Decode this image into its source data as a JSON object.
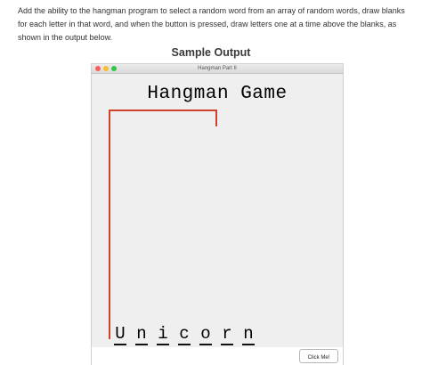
{
  "instructions": {
    "text": "Add the ability to the hangman program to select a random word from an array of random words, draw blanks for each letter in that word, and when the button is pressed, draw letters one at a time above the blanks, as shown in the output below."
  },
  "sample_heading": "Sample Output",
  "window": {
    "title": "Hangman Part II",
    "game_title": "Hangman Game",
    "letters": [
      "U",
      "n",
      "i",
      "c",
      "o",
      "r",
      "n"
    ],
    "button_label": "Click Me!"
  },
  "colors": {
    "gallows": "#d0412c",
    "window_background": "#efefef"
  }
}
